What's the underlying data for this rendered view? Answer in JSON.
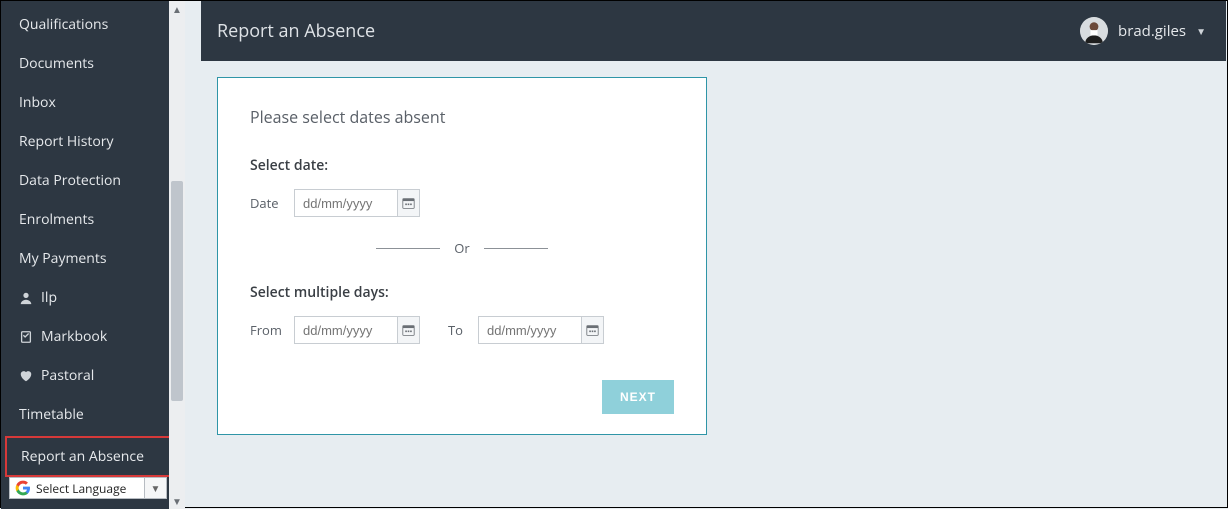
{
  "sidebar": {
    "items": [
      {
        "label": "Qualifications",
        "icon": ""
      },
      {
        "label": "Documents",
        "icon": ""
      },
      {
        "label": "Inbox",
        "icon": ""
      },
      {
        "label": "Report History",
        "icon": ""
      },
      {
        "label": "Data Protection",
        "icon": ""
      },
      {
        "label": "Enrolments",
        "icon": ""
      },
      {
        "label": "My Payments",
        "icon": ""
      },
      {
        "label": "Ilp",
        "icon": "person"
      },
      {
        "label": "Markbook",
        "icon": "clipboard"
      },
      {
        "label": "Pastoral",
        "icon": "heart"
      },
      {
        "label": "Timetable",
        "icon": ""
      },
      {
        "label": "Report an Absence",
        "icon": "",
        "active": true
      }
    ],
    "language_label": "Select Language"
  },
  "header": {
    "title": "Report an Absence",
    "username": "brad.giles"
  },
  "form": {
    "heading": "Please select dates absent",
    "select_date_label": "Select date:",
    "date_label": "Date",
    "date_placeholder": "dd/mm/yyyy",
    "or_label": "Or",
    "select_multiple_label": "Select multiple days:",
    "from_label": "From",
    "from_placeholder": "dd/mm/yyyy",
    "to_label": "To",
    "to_placeholder": "dd/mm/yyyy",
    "next_label": "NEXT"
  }
}
